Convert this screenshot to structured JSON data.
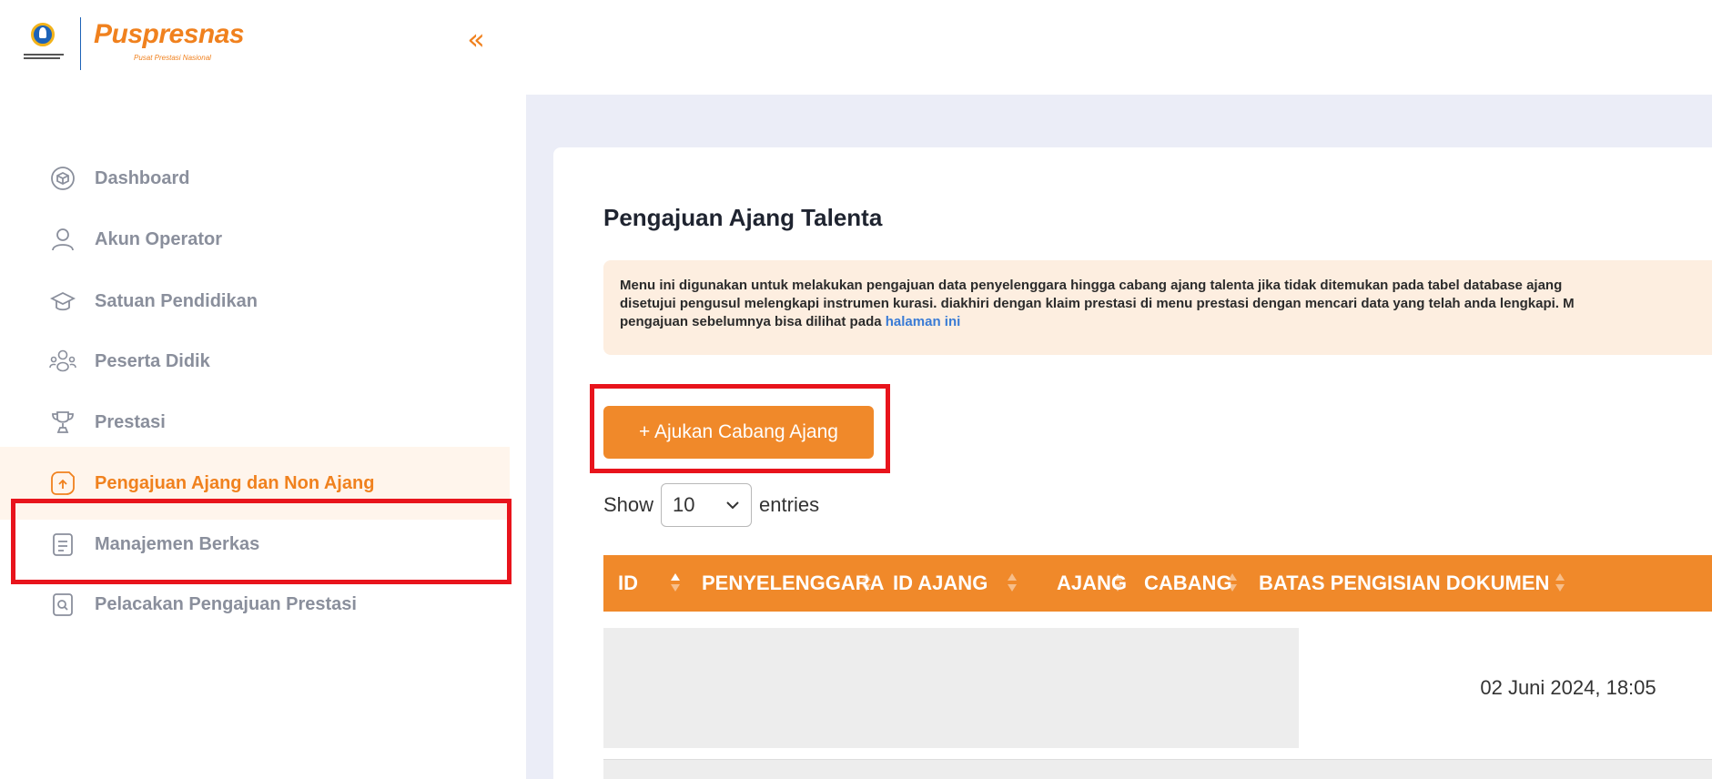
{
  "brand": {
    "name": "Puspresnas",
    "tagline": "Pusat Prestasi Nasional",
    "collapse_glyph": "«"
  },
  "sidebar": {
    "items": [
      {
        "label": "Dashboard",
        "icon": "cube-icon"
      },
      {
        "label": "Akun Operator",
        "icon": "user-icon"
      },
      {
        "label": "Satuan Pendidikan",
        "icon": "graduation-cap-icon"
      },
      {
        "label": "Peserta Didik",
        "icon": "users-icon"
      },
      {
        "label": "Prestasi",
        "icon": "trophy-icon"
      },
      {
        "label": "Pengajuan Ajang dan Non Ajang",
        "icon": "upload-file-icon",
        "active": true
      },
      {
        "label": "Manajemen Berkas",
        "icon": "document-icon"
      },
      {
        "label": "Pelacakan Pengajuan Prestasi",
        "icon": "search-file-icon"
      }
    ]
  },
  "main": {
    "title": "Pengajuan Ajang Talenta",
    "notice": {
      "line1": "Menu ini digunakan untuk melakukan pengajuan data penyelenggara hingga cabang ajang talenta jika tidak ditemukan pada tabel database ajang",
      "line2": "disetujui pengusul melengkapi instrumen kurasi. diakhiri dengan klaim prestasi di menu prestasi dengan mencari data yang telah anda lengkapi. M",
      "line3_prefix": "pengajuan sebelumnya bisa dilihat pada",
      "link_text": "halaman ini"
    },
    "add_button_label": "+ Ajukan Cabang Ajang",
    "entries": {
      "show_label": "Show",
      "selected": "10",
      "suffix": "entries"
    },
    "table": {
      "columns": [
        "ID",
        "PENYELENGGARA",
        "ID AJANG",
        "AJANG",
        "CABANG",
        "BATAS PENGISIAN DOKUMEN"
      ],
      "rows": [
        {
          "batas": "02 Juni 2024, 18:05"
        }
      ]
    }
  },
  "colors": {
    "accent": "#f0892a",
    "highlight": "#e8141c",
    "link": "#3a7bd5"
  }
}
